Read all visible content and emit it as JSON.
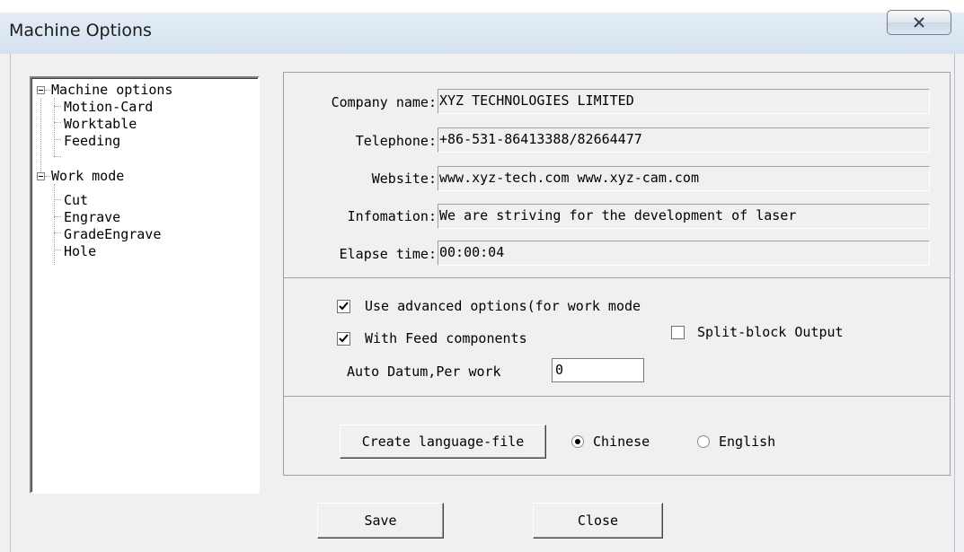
{
  "window": {
    "title": "Machine Options",
    "close_icon": "close-icon"
  },
  "tree": {
    "items": [
      {
        "label": "Machine options",
        "children": [
          "Motion-Card",
          "Worktable",
          "Feeding"
        ]
      },
      {
        "label": "Work mode",
        "children": [
          "Cut",
          "Engrave",
          "GradeEngrave",
          "Hole"
        ]
      }
    ]
  },
  "info": {
    "company_label": "Company name:",
    "company_value": "XYZ TECHNOLOGIES LIMITED",
    "telephone_label": "Telephone:",
    "telephone_value": "+86-531-86413388/82664477",
    "website_label": "Website:",
    "website_value": "www.xyz-tech.com www.xyz-cam.com",
    "information_label": "Infomation:",
    "information_value": "We are striving for the development of laser",
    "elapse_label": "Elapse time:",
    "elapse_value": "00:00:04"
  },
  "options": {
    "advanced_label": "Use advanced options(for work mode",
    "advanced_checked": true,
    "feed_label": "With Feed components",
    "feed_checked": true,
    "split_label": "Split-block Output",
    "split_checked": false,
    "datum_label": "Auto Datum,Per work",
    "datum_value": "0"
  },
  "language": {
    "create_button": "Create language-file",
    "chinese_label": "Chinese",
    "english_label": "English",
    "selected": "Chinese"
  },
  "footer": {
    "save_label": "Save",
    "close_label": "Close"
  }
}
